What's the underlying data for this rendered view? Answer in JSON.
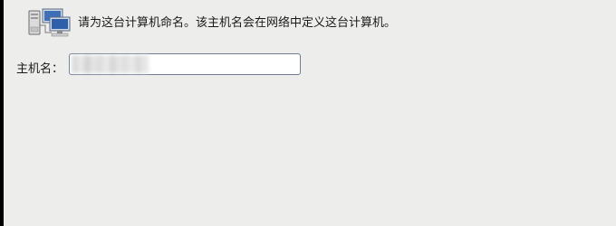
{
  "header": {
    "icon": "network-computers-icon",
    "instruction": "请为这台计算机命名。该主机名会在网络中定义这台计算机。"
  },
  "hostname": {
    "label": "主机名：",
    "value": "",
    "redacted": true
  },
  "colors": {
    "background": "#ededec",
    "input_border": "#6f7c93",
    "left_edge": "#000000"
  }
}
